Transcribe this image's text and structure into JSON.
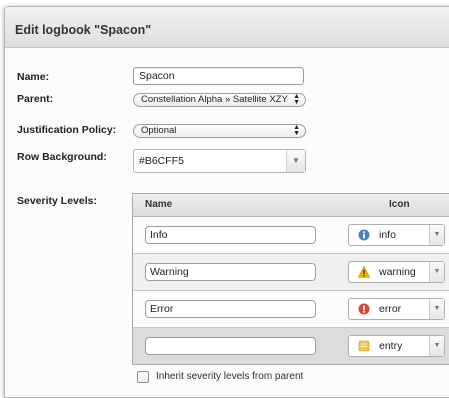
{
  "dialog": {
    "title": "Edit logbook \"Spacon\""
  },
  "form": {
    "name_label": "Name:",
    "name_value": "Spacon",
    "parent_label": "Parent:",
    "parent_value": "Constellation Alpha » Satellite XZY",
    "justification_label": "Justification Policy:",
    "justification_value": "Optional",
    "row_background_label": "Row Background:",
    "row_background_value": "#B6CFF5"
  },
  "severity": {
    "label": "Severity Levels:",
    "columns": {
      "name": "Name",
      "icon": "Icon"
    },
    "rows": [
      {
        "name": "Info",
        "icon_label": "info",
        "icon_name": "info-icon",
        "icon_color": "#4a7fd0"
      },
      {
        "name": "Warning",
        "icon_label": "warning",
        "icon_name": "warning-icon",
        "icon_color": "#f0b400"
      },
      {
        "name": "Error",
        "icon_label": "error",
        "icon_name": "error-icon",
        "icon_color": "#d8472b"
      },
      {
        "name": "",
        "icon_label": "entry",
        "icon_name": "entry-icon",
        "icon_color": "#f3c24a"
      }
    ],
    "inherit_label": "Inherit severity levels from parent",
    "inherit_checked": false
  }
}
